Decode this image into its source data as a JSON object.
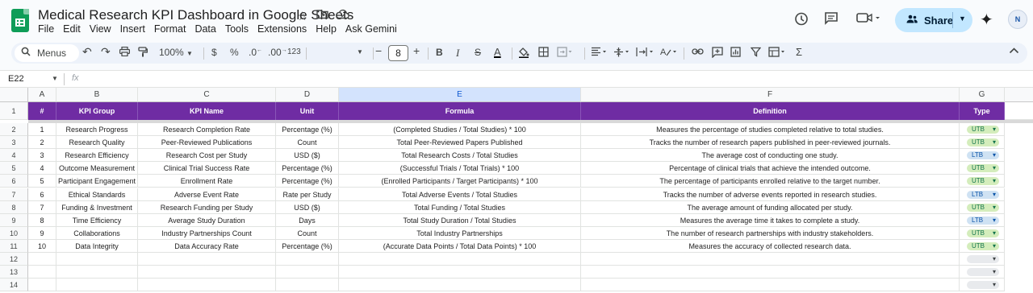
{
  "app": {
    "title": "Medical Research KPI Dashboard in Google Sheets",
    "menu": [
      "File",
      "Edit",
      "View",
      "Insert",
      "Format",
      "Data",
      "Tools",
      "Extensions",
      "Help",
      "Ask Gemini"
    ],
    "share_label": "Share",
    "avatar_label": "N"
  },
  "toolbar": {
    "menus_label": "Menus",
    "zoom": "100%",
    "currency": "$",
    "percent": "%",
    "dec_decrease": ".0",
    "dec_increase": ".00",
    "number_format": "123",
    "font_size": "8",
    "bold": "B",
    "italic": "I",
    "text_color_label": "A"
  },
  "formula_bar": {
    "cell_ref": "E22",
    "fx": "fx",
    "value": ""
  },
  "columns": [
    "A",
    "B",
    "C",
    "D",
    "E",
    "F",
    "G"
  ],
  "active_column": "E",
  "table": {
    "headers": [
      "#",
      "KPI Group",
      "KPI Name",
      "Unit",
      "Formula",
      "Definition",
      "Type"
    ],
    "rows": [
      [
        "1",
        "Research Progress",
        "Research Completion Rate",
        "Percentage (%)",
        "(Completed Studies / Total Studies) * 100",
        "Measures the percentage of studies completed relative to total studies.",
        "UTB"
      ],
      [
        "2",
        "Research Quality",
        "Peer-Reviewed Publications",
        "Count",
        "Total Peer-Reviewed Papers Published",
        "Tracks the number of research papers published in peer-reviewed journals.",
        "UTB"
      ],
      [
        "3",
        "Research Efficiency",
        "Research Cost per Study",
        "USD ($)",
        "Total Research Costs / Total Studies",
        "The average cost of conducting one study.",
        "LTB"
      ],
      [
        "4",
        "Outcome Measurement",
        "Clinical Trial Success Rate",
        "Percentage (%)",
        "(Successful Trials / Total Trials) * 100",
        "Percentage of clinical trials that achieve the intended outcome.",
        "UTB"
      ],
      [
        "5",
        "Participant Engagement",
        "Enrollment Rate",
        "Percentage (%)",
        "(Enrolled Participants / Target Participants) * 100",
        "The percentage of participants enrolled relative to the target number.",
        "UTB"
      ],
      [
        "6",
        "Ethical Standards",
        "Adverse Event Rate",
        "Rate per Study",
        "Total Adverse Events / Total Studies",
        "Tracks the number of adverse events reported in research studies.",
        "LTB"
      ],
      [
        "7",
        "Funding & Investment",
        "Research Funding per Study",
        "USD ($)",
        "Total Funding / Total Studies",
        "The average amount of funding allocated per study.",
        "UTB"
      ],
      [
        "8",
        "Time Efficiency",
        "Average Study Duration",
        "Days",
        "Total Study Duration / Total Studies",
        "Measures the average time it takes to complete a study.",
        "LTB"
      ],
      [
        "9",
        "Collaborations",
        "Industry Partnerships Count",
        "Count",
        "Total Industry Partnerships",
        "The number of research partnerships with industry stakeholders.",
        "UTB"
      ],
      [
        "10",
        "Data Integrity",
        "Data Accuracy Rate",
        "Percentage (%)",
        "(Accurate Data Points / Total Data Points) * 100",
        "Measures the accuracy of collected research data.",
        "UTB"
      ]
    ]
  },
  "row_numbers": [
    "1",
    "2",
    "3",
    "4",
    "5",
    "6",
    "7",
    "8",
    "9",
    "10",
    "11",
    "12",
    "13",
    "14"
  ],
  "colors": {
    "header_bg": "#6f2ca3",
    "utb_chip": "#d4edbc",
    "ltb_chip": "#cfe2f3",
    "share_bg": "#c2e7ff",
    "sheets_green": "#0f9d58"
  }
}
